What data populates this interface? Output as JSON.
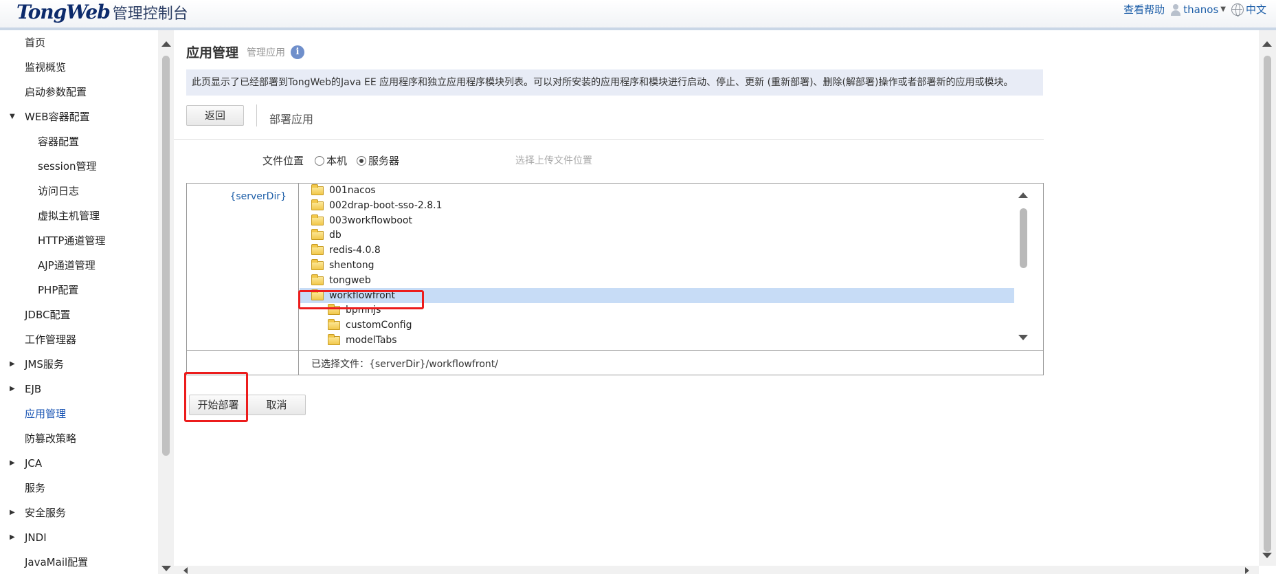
{
  "header": {
    "logo_text": "TongWeb",
    "logo_subtitle": "管理控制台",
    "help_link": "查看帮助",
    "username": "thanos",
    "language": "中文"
  },
  "sidebar": {
    "items": [
      {
        "label": "首页",
        "level": 1,
        "arrow": ""
      },
      {
        "label": "监视概览",
        "level": 1,
        "arrow": ""
      },
      {
        "label": "启动参数配置",
        "level": 1,
        "arrow": ""
      },
      {
        "label": "WEB容器配置",
        "level": 1,
        "arrow": "expanded"
      },
      {
        "label": "容器配置",
        "level": 2,
        "arrow": ""
      },
      {
        "label": "session管理",
        "level": 2,
        "arrow": ""
      },
      {
        "label": "访问日志",
        "level": 2,
        "arrow": ""
      },
      {
        "label": "虚拟主机管理",
        "level": 2,
        "arrow": ""
      },
      {
        "label": "HTTP通道管理",
        "level": 2,
        "arrow": ""
      },
      {
        "label": "AJP通道管理",
        "level": 2,
        "arrow": ""
      },
      {
        "label": "PHP配置",
        "level": 2,
        "arrow": ""
      },
      {
        "label": "JDBC配置",
        "level": 1,
        "arrow": ""
      },
      {
        "label": "工作管理器",
        "level": 1,
        "arrow": ""
      },
      {
        "label": "JMS服务",
        "level": 1,
        "arrow": "collapsed"
      },
      {
        "label": "EJB",
        "level": 1,
        "arrow": "collapsed"
      },
      {
        "label": "应用管理",
        "level": 1,
        "arrow": "",
        "active": true
      },
      {
        "label": "防篡改策略",
        "level": 1,
        "arrow": ""
      },
      {
        "label": "JCA",
        "level": 1,
        "arrow": "collapsed"
      },
      {
        "label": "服务",
        "level": 1,
        "arrow": ""
      },
      {
        "label": "安全服务",
        "level": 1,
        "arrow": "collapsed"
      },
      {
        "label": "JNDI",
        "level": 1,
        "arrow": "collapsed"
      },
      {
        "label": "JavaMail配置",
        "level": 1,
        "arrow": ""
      }
    ]
  },
  "main": {
    "title": "应用管理",
    "subtitle": "管理应用",
    "description": "此页显示了已经部署到TongWeb的Java EE 应用程序和独立应用程序模块列表。可以对所安装的应用程序和模块进行启动、停止、更新 (重新部署)、删除(解部署)操作或者部署新的应用或模块。",
    "back_button": "返回",
    "section_title": "部署应用",
    "file_location_label": "文件位置",
    "radio_local": "本机",
    "radio_server": "服务器",
    "radio_selected": "服务器",
    "upload_hint": "选择上传文件位置",
    "server_dir": "{serverDir}",
    "tree": [
      {
        "name": "001nacos",
        "depth": 0,
        "open": false
      },
      {
        "name": "002drap-boot-sso-2.8.1",
        "depth": 0,
        "open": false
      },
      {
        "name": "003workflowboot",
        "depth": 0,
        "open": false
      },
      {
        "name": "db",
        "depth": 0,
        "open": false
      },
      {
        "name": "redis-4.0.8",
        "depth": 0,
        "open": false
      },
      {
        "name": "shentong",
        "depth": 0,
        "open": false
      },
      {
        "name": "tongweb",
        "depth": 0,
        "open": false
      },
      {
        "name": "workflowfront",
        "depth": 0,
        "open": true,
        "selected": true
      },
      {
        "name": "bpmnjs",
        "depth": 1,
        "open": false
      },
      {
        "name": "customConfig",
        "depth": 1,
        "open": false
      },
      {
        "name": "modelTabs",
        "depth": 1,
        "open": false
      }
    ],
    "selected_file_label": "已选择文件：",
    "selected_file_path": "{serverDir}/workflowfront/",
    "deploy_button": "开始部署",
    "cancel_button": "取消"
  },
  "colors": {
    "link": "#1d5ea8",
    "selection": "#c7dcf6",
    "description_bg": "#e8ecf6",
    "highlight_box": "#ec1c1c"
  }
}
